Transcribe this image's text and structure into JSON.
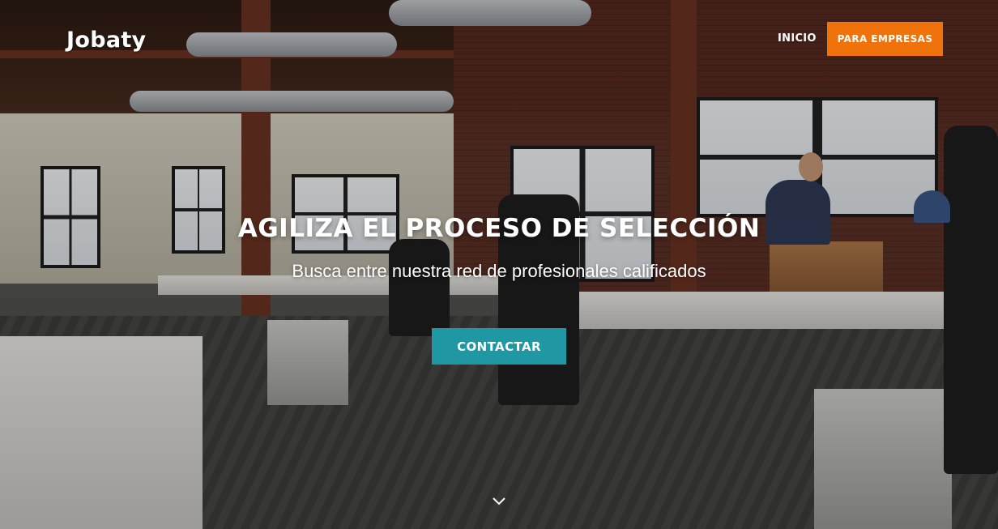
{
  "navbar": {
    "brand": "Jobaty",
    "links": [
      {
        "label": "INICIO"
      }
    ],
    "cta_label": "PARA EMPRESAS"
  },
  "hero": {
    "headline": "AGILIZA EL PROCESO DE SELECCIÓN",
    "subheadline": "Busca entre nuestra red de profesionales calificados",
    "button_label": "CONTACTAR",
    "scroll_icon": "chevron-down-icon",
    "background": "office-photo"
  },
  "colors": {
    "cta_orange": "#f0720a",
    "button_teal": "#1f98a3",
    "text": "#ffffff"
  }
}
